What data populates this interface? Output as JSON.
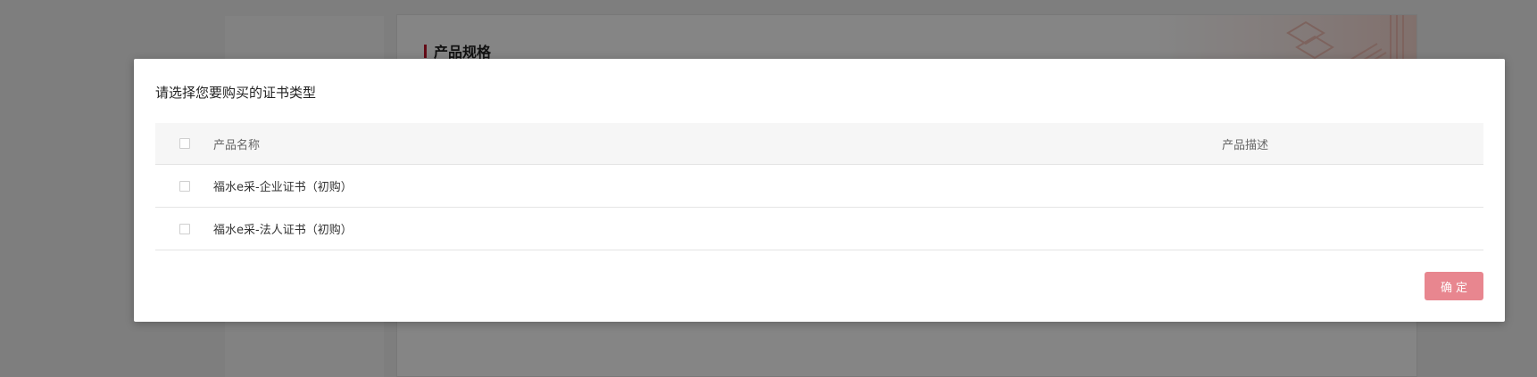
{
  "background": {
    "section_title": "产品规格"
  },
  "modal": {
    "title": "请选择您要购买的证书类型",
    "table": {
      "headers": {
        "name": "产品名称",
        "description": "产品描述"
      },
      "rows": [
        {
          "name": "福水e采-企业证书（初购）",
          "description": "",
          "checked": false
        },
        {
          "name": "福水e采-法人证书（初购）",
          "description": "",
          "checked": false
        }
      ]
    },
    "confirm_label": "确定"
  },
  "colors": {
    "accent": "#c0142b",
    "confirm_button": "#e8868f",
    "overlay": "rgba(0,0,0,0.48)"
  }
}
